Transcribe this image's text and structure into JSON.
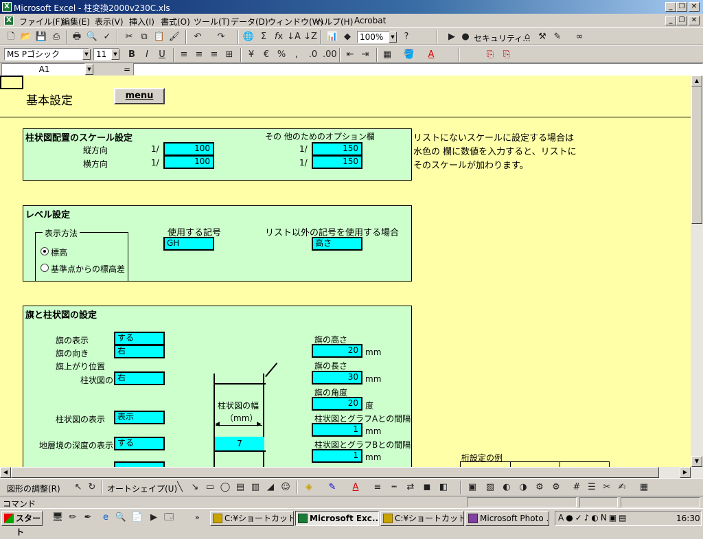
{
  "window": {
    "title": "Microsoft Excel - 柱変換2000v230C.xls",
    "app_icon": "excel-icon"
  },
  "menubar": {
    "items": [
      "ファイル(F)",
      "編集(E)",
      "表示(V)",
      "挿入(I)",
      "書式(O)",
      "ツール(T)",
      "データ(D)",
      "ウィンドウ(W)",
      "ヘルプ(H)",
      "Acrobat"
    ]
  },
  "standard_toolbar": {
    "zoom": "100%",
    "security_label": "セキュリティ..."
  },
  "format_toolbar": {
    "font_name": "MS Pゴシック",
    "font_size": "11",
    "bold": "B",
    "italic": "I",
    "underline": "U",
    "euro": "€",
    "percent": "%"
  },
  "formula_bar": {
    "name_box": "A1",
    "equals": "="
  },
  "sheet": {
    "title": "基本設定",
    "menu_button": "menu",
    "scale_panel": {
      "heading": "柱状図配置のスケール設定",
      "option_heading": "その 他のためのオプション欄",
      "vertical_label": "縦方向",
      "horizontal_label": "横方向",
      "ratio_prefix": "1/",
      "vertical_value": "100",
      "horizontal_value": "100",
      "option_vertical_value": "150",
      "option_horizontal_value": "150"
    },
    "note": {
      "line1": "リストにないスケールに設定する場合は",
      "line2": "水色の 欄に数値を入力すると、リストに",
      "line3": "そのスケールが加わります。"
    },
    "level_panel": {
      "heading": "レベル設定",
      "display_group": "表示方法",
      "radio_elevation": "標高",
      "radio_relative": "基準点からの標高差",
      "symbol_label": "使用する記号",
      "symbol_value": "GH",
      "other_label": "リスト以外の記号を使用する場合",
      "other_value": "高さ"
    },
    "flag_panel": {
      "heading": "旗と柱状図の設定",
      "flag_display_label": "旗の表示",
      "flag_display_value": "する",
      "flag_direction_label": "旗の向き",
      "flag_direction_value": "右",
      "flag_rise_label": "旗上がり位置",
      "column_label": "柱状図の",
      "column_value": "右",
      "column_display_label": "柱状図の表示",
      "column_display_value": "表示",
      "depth_display_label": "地層境の深度の表示",
      "depth_display_value": "する",
      "diagram_width_label": "柱状図の幅",
      "diagram_unit": "（mm）",
      "diagram_width_value": "7",
      "flag_height_label": "旗の高さ",
      "flag_height_value": "20",
      "flag_length_label": "旗の長さ",
      "flag_length_value": "30",
      "flag_angle_label": "旗の角度",
      "flag_angle_value": "20",
      "gap_a_label": "柱状図とグラフAとの間隔",
      "gap_a_value": "1",
      "gap_b_label": "柱状図とグラフBとの間隔",
      "gap_b_value": "1",
      "mm": "mm",
      "degree": "度"
    },
    "digit_example": "桁設定の例"
  },
  "draw_toolbar": {
    "shape_adjust": "図形の調整(R)",
    "autoshape": "オートシェイプ(U)"
  },
  "status_bar": {
    "text": "コマンド"
  },
  "taskbar": {
    "start": "スタート",
    "tasks": [
      "C:¥ショートカット集...",
      "Microsoft Exc...",
      "C:¥ショートカット集...",
      "Microsoft Photo ..."
    ],
    "clock": "16:30"
  },
  "colors": {
    "sheet_bg": "#ffffa8",
    "panel_bg": "#ccffcc",
    "input_bg": "#00ffff",
    "title_bar": "#0a246a"
  }
}
